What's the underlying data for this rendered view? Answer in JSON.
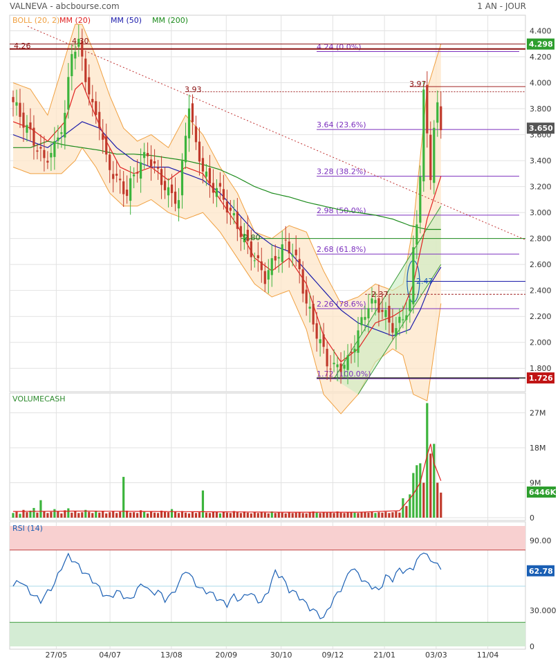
{
  "header": {
    "title": "VALNEVA - abcbourse.com",
    "period": "1 AN - JOUR"
  },
  "colors": {
    "boll": "#f0a040",
    "boll_fill": "#fde6c8",
    "mm20": "#e02020",
    "mm50": "#1a1aaa",
    "mm200": "#1a8a1a",
    "up": "#3cb43c",
    "down": "#c0392b",
    "fib": "#7b2fbe",
    "price_badge": "#555555",
    "green_badge": "#2e9e2e",
    "red_badge": "#c01414",
    "rsi": "#1a5fb4",
    "rsi_upper_zone": "#f8d0d0",
    "rsi_lower_zone": "#d4ecd4",
    "grid": "#e2e2e2"
  },
  "chart_data": [
    {
      "type": "candlestick",
      "title": "VALNEVA",
      "legend": [
        "BOLL (20, 2)",
        "MM (20)",
        "MM (50)",
        "MM (200)"
      ],
      "ylim": [
        1.62,
        4.52
      ],
      "y_ticks": [
        "4.400",
        "4.200",
        "4.000",
        "3.800",
        "3.600",
        "3.400",
        "3.200",
        "3.000",
        "2.800",
        "2.600",
        "2.400",
        "2.200",
        "2.000",
        "1.800"
      ],
      "x_ticks": [
        "27/05",
        "04/07",
        "13/08",
        "20/09",
        "30/10",
        "09/12",
        "21/01",
        "03/03",
        "11/04"
      ],
      "close_path": [
        [
          0,
          3.85
        ],
        [
          3,
          3.7
        ],
        [
          6,
          3.55
        ],
        [
          9,
          3.4
        ],
        [
          12,
          3.5
        ],
        [
          15,
          3.75
        ],
        [
          17,
          4.25
        ],
        [
          19,
          4.3
        ],
        [
          21,
          4.05
        ],
        [
          23,
          3.8
        ],
        [
          25,
          3.7
        ],
        [
          27,
          3.4
        ],
        [
          30,
          3.25
        ],
        [
          33,
          3.15
        ],
        [
          36,
          3.35
        ],
        [
          39,
          3.45
        ],
        [
          42,
          3.3
        ],
        [
          45,
          3.15
        ],
        [
          48,
          3.1
        ],
        [
          50,
          3.6
        ],
        [
          51,
          3.85
        ],
        [
          53,
          3.5
        ],
        [
          55,
          3.35
        ],
        [
          57,
          3.2
        ],
        [
          59,
          3.2
        ],
        [
          61,
          3.1
        ],
        [
          63,
          3.0
        ],
        [
          65,
          2.9
        ],
        [
          67,
          2.8
        ],
        [
          69,
          2.7
        ],
        [
          71,
          2.6
        ],
        [
          73,
          2.5
        ],
        [
          75,
          2.6
        ],
        [
          77,
          2.7
        ],
        [
          79,
          2.75
        ],
        [
          81,
          2.7
        ],
        [
          83,
          2.55
        ],
        [
          85,
          2.3
        ],
        [
          87,
          2.15
        ],
        [
          89,
          2.0
        ],
        [
          91,
          1.85
        ],
        [
          93,
          1.8
        ],
        [
          95,
          1.82
        ],
        [
          97,
          1.85
        ],
        [
          99,
          2.0
        ],
        [
          101,
          2.15
        ],
        [
          103,
          2.3
        ],
        [
          105,
          2.3
        ],
        [
          107,
          2.25
        ],
        [
          109,
          2.15
        ],
        [
          111,
          2.1
        ],
        [
          113,
          2.2
        ],
        [
          115,
          2.3
        ],
        [
          116,
          2.7
        ],
        [
          117,
          2.95
        ],
        [
          118,
          3.3
        ],
        [
          119,
          3.9
        ],
        [
          120,
          3.6
        ],
        [
          121,
          3.3
        ],
        [
          122,
          3.65
        ],
        [
          123,
          3.8
        ],
        [
          124,
          3.65
        ]
      ],
      "mm20_path": [
        [
          0,
          3.7
        ],
        [
          5,
          3.65
        ],
        [
          10,
          3.55
        ],
        [
          15,
          3.7
        ],
        [
          18,
          3.95
        ],
        [
          20,
          4.0
        ],
        [
          23,
          3.8
        ],
        [
          27,
          3.55
        ],
        [
          31,
          3.35
        ],
        [
          35,
          3.3
        ],
        [
          40,
          3.35
        ],
        [
          45,
          3.25
        ],
        [
          50,
          3.35
        ],
        [
          55,
          3.3
        ],
        [
          60,
          3.1
        ],
        [
          65,
          2.9
        ],
        [
          70,
          2.65
        ],
        [
          75,
          2.55
        ],
        [
          80,
          2.65
        ],
        [
          85,
          2.45
        ],
        [
          90,
          2.05
        ],
        [
          95,
          1.85
        ],
        [
          100,
          1.95
        ],
        [
          105,
          2.15
        ],
        [
          110,
          2.2
        ],
        [
          113,
          2.25
        ],
        [
          116,
          2.45
        ],
        [
          120,
          2.95
        ],
        [
          124,
          3.28
        ]
      ],
      "mm50_path": [
        [
          0,
          3.6
        ],
        [
          5,
          3.55
        ],
        [
          10,
          3.5
        ],
        [
          15,
          3.6
        ],
        [
          20,
          3.7
        ],
        [
          25,
          3.65
        ],
        [
          30,
          3.5
        ],
        [
          35,
          3.4
        ],
        [
          40,
          3.35
        ],
        [
          45,
          3.35
        ],
        [
          50,
          3.3
        ],
        [
          55,
          3.25
        ],
        [
          60,
          3.15
        ],
        [
          65,
          3.0
        ],
        [
          70,
          2.85
        ],
        [
          75,
          2.75
        ],
        [
          80,
          2.7
        ],
        [
          85,
          2.55
        ],
        [
          90,
          2.4
        ],
        [
          95,
          2.25
        ],
        [
          100,
          2.15
        ],
        [
          105,
          2.1
        ],
        [
          110,
          2.05
        ],
        [
          115,
          2.1
        ],
        [
          118,
          2.25
        ],
        [
          121,
          2.45
        ],
        [
          124,
          2.58
        ]
      ],
      "mm200_path": [
        [
          0,
          3.5
        ],
        [
          5,
          3.5
        ],
        [
          10,
          3.55
        ],
        [
          15,
          3.52
        ],
        [
          20,
          3.5
        ],
        [
          25,
          3.48
        ],
        [
          30,
          3.45
        ],
        [
          35,
          3.45
        ],
        [
          40,
          3.44
        ],
        [
          45,
          3.42
        ],
        [
          50,
          3.4
        ],
        [
          55,
          3.37
        ],
        [
          60,
          3.33
        ],
        [
          65,
          3.27
        ],
        [
          70,
          3.2
        ],
        [
          75,
          3.15
        ],
        [
          80,
          3.12
        ],
        [
          85,
          3.08
        ],
        [
          90,
          3.05
        ],
        [
          95,
          3.02
        ],
        [
          100,
          3.0
        ],
        [
          105,
          2.98
        ],
        [
          110,
          2.95
        ],
        [
          115,
          2.9
        ],
        [
          120,
          2.87
        ],
        [
          124,
          2.87
        ]
      ],
      "boll_upper_path": [
        [
          0,
          4.0
        ],
        [
          5,
          3.95
        ],
        [
          10,
          3.75
        ],
        [
          14,
          4.1
        ],
        [
          18,
          4.45
        ],
        [
          20,
          4.45
        ],
        [
          24,
          4.2
        ],
        [
          28,
          3.9
        ],
        [
          32,
          3.65
        ],
        [
          36,
          3.55
        ],
        [
          40,
          3.6
        ],
        [
          45,
          3.5
        ],
        [
          50,
          3.75
        ],
        [
          55,
          3.6
        ],
        [
          60,
          3.35
        ],
        [
          65,
          3.15
        ],
        [
          70,
          2.85
        ],
        [
          75,
          2.8
        ],
        [
          80,
          2.9
        ],
        [
          85,
          2.85
        ],
        [
          90,
          2.55
        ],
        [
          95,
          2.3
        ],
        [
          100,
          2.35
        ],
        [
          105,
          2.45
        ],
        [
          110,
          2.4
        ],
        [
          113,
          2.45
        ],
        [
          116,
          2.9
        ],
        [
          120,
          3.95
        ],
        [
          124,
          4.3
        ]
      ],
      "boll_lower_path": [
        [
          0,
          3.35
        ],
        [
          5,
          3.3
        ],
        [
          10,
          3.3
        ],
        [
          14,
          3.3
        ],
        [
          18,
          3.4
        ],
        [
          20,
          3.5
        ],
        [
          24,
          3.35
        ],
        [
          28,
          3.15
        ],
        [
          32,
          3.05
        ],
        [
          36,
          3.05
        ],
        [
          40,
          3.1
        ],
        [
          45,
          3.0
        ],
        [
          50,
          2.95
        ],
        [
          55,
          3.0
        ],
        [
          60,
          2.85
        ],
        [
          65,
          2.65
        ],
        [
          70,
          2.45
        ],
        [
          75,
          2.35
        ],
        [
          80,
          2.4
        ],
        [
          85,
          2.1
        ],
        [
          90,
          1.6
        ],
        [
          95,
          1.45
        ],
        [
          100,
          1.6
        ],
        [
          105,
          1.85
        ],
        [
          110,
          1.95
        ],
        [
          113,
          1.9
        ],
        [
          116,
          1.6
        ],
        [
          120,
          1.55
        ],
        [
          124,
          2.3
        ]
      ],
      "fibonacci": [
        {
          "price": 4.24,
          "label": "4.24  (0.0%)"
        },
        {
          "price": 3.64,
          "label": "3.64  (23.6%)"
        },
        {
          "price": 3.28,
          "label": "3.28  (38.2%)"
        },
        {
          "price": 2.98,
          "label": "2.98  (50.0%)"
        },
        {
          "price": 2.68,
          "label": "2.68  (61.8%)"
        },
        {
          "price": 2.26,
          "label": "2.26  (78.6%)"
        },
        {
          "price": 1.72,
          "label": "1.72  (100.0%)"
        }
      ],
      "annotations": [
        {
          "price": 4.26,
          "label": "4.26"
        },
        {
          "price": 4.3,
          "label": "4.30"
        },
        {
          "price": 3.93,
          "label": "3.93"
        },
        {
          "price": 3.97,
          "label": "3.97"
        },
        {
          "price": 2.8,
          "label": "2.80"
        },
        {
          "price": 2.37,
          "label": "2.37"
        },
        {
          "price": 2.47,
          "label": "2.47"
        }
      ],
      "price_badges": [
        {
          "value": "4.298",
          "price": 4.298,
          "color": "green"
        },
        {
          "value": "3.650",
          "price": 3.65,
          "color": "grey"
        },
        {
          "value": "1.726",
          "price": 1.726,
          "color": "red"
        }
      ]
    },
    {
      "type": "bar",
      "title": "VOLUMECASH",
      "ylim": [
        0,
        31
      ],
      "y_ticks": [
        "27M",
        "18M",
        "9M",
        "0"
      ],
      "badge": "6446K",
      "values": [
        1.2,
        1.5,
        1.0,
        2.0,
        1.4,
        1.8,
        2.5,
        1.3,
        3.0,
        1.7,
        1.2,
        1.5,
        2.2,
        1.6,
        1.1,
        1.9,
        2.4,
        1.3,
        1.7,
        1.2,
        1.4,
        2.0,
        1.5,
        1.2,
        1.8,
        1.3,
        1.6,
        1.1,
        1.4,
        1.7,
        1.2,
        1.5,
        2.5,
        1.8,
        1.3,
        1.4,
        1.2,
        1.9,
        1.5,
        1.1,
        1.6,
        1.3,
        1.2,
        1.8,
        1.5,
        1.4,
        2.2,
        1.6,
        1.2,
        1.7,
        1.3,
        1.1,
        1.5,
        1.2,
        1.4,
        1.8,
        1.3,
        1.2,
        1.6,
        1.4,
        1.1,
        1.5,
        1.3,
        1.2,
        1.7,
        1.4,
        1.2,
        1.6,
        1.3,
        1.1,
        1.5,
        1.2,
        1.4,
        1.3,
        1.1,
        1.6,
        1.2,
        1.5,
        1.3,
        1.1,
        1.4,
        1.2,
        1.3,
        1.5,
        1.2,
        1.1,
        1.4,
        1.6,
        1.3,
        1.2,
        1.5,
        1.3,
        1.4,
        1.2,
        1.6,
        1.3,
        1.2,
        1.5,
        1.4,
        1.3,
        1.2,
        1.4,
        1.5,
        1.3,
        1.6,
        1.2,
        1.4,
        1.3,
        1.5,
        1.2,
        1.4,
        1.6,
        1.3,
        2.0,
        3.0,
        6.0,
        10.0,
        7.0,
        14.0,
        9.0,
        29.0,
        12.0,
        19.0,
        9.0,
        6.45
      ],
      "spikes": [
        [
          8,
          4.5
        ],
        [
          32,
          10.5
        ],
        [
          55,
          7.0
        ],
        [
          113,
          5.0
        ],
        [
          116,
          11.5
        ],
        [
          117,
          13.5
        ],
        [
          120,
          29.5
        ],
        [
          121,
          16.5
        ]
      ],
      "colors_up": [
        0,
        2,
        5,
        6,
        8,
        12,
        16,
        21,
        24,
        32,
        38,
        46,
        55,
        60,
        75,
        88,
        99,
        105,
        113,
        115,
        116,
        117,
        118,
        120,
        122
      ],
      "average_path": [
        [
          0,
          1.6
        ],
        [
          20,
          1.7
        ],
        [
          40,
          1.6
        ],
        [
          60,
          1.5
        ],
        [
          80,
          1.4
        ],
        [
          100,
          1.4
        ],
        [
          112,
          1.8
        ],
        [
          116,
          6.0
        ],
        [
          118,
          9.0
        ],
        [
          120,
          16.0
        ],
        [
          121,
          19.0
        ],
        [
          122,
          14.0
        ],
        [
          124,
          9.5
        ]
      ]
    },
    {
      "type": "line",
      "title": "RSI (14)",
      "ylim": [
        0,
        100
      ],
      "y_ticks": [
        "90.00",
        "30.000",
        "0"
      ],
      "badge": "62.78",
      "upper_zone": [
        80,
        100
      ],
      "lower_zone": [
        0,
        20
      ],
      "midline": 50,
      "values_path": [
        [
          0,
          50
        ],
        [
          2,
          55
        ],
        [
          4,
          48
        ],
        [
          6,
          42
        ],
        [
          8,
          38
        ],
        [
          10,
          45
        ],
        [
          12,
          52
        ],
        [
          14,
          66
        ],
        [
          16,
          75
        ],
        [
          18,
          70
        ],
        [
          20,
          63
        ],
        [
          22,
          58
        ],
        [
          24,
          52
        ],
        [
          26,
          44
        ],
        [
          28,
          40
        ],
        [
          30,
          46
        ],
        [
          32,
          42
        ],
        [
          34,
          38
        ],
        [
          36,
          48
        ],
        [
          38,
          52
        ],
        [
          40,
          44
        ],
        [
          42,
          46
        ],
        [
          44,
          39
        ],
        [
          46,
          43
        ],
        [
          48,
          52
        ],
        [
          50,
          64
        ],
        [
          52,
          56
        ],
        [
          54,
          48
        ],
        [
          56,
          46
        ],
        [
          58,
          43
        ],
        [
          60,
          38
        ],
        [
          62,
          35
        ],
        [
          64,
          42
        ],
        [
          66,
          38
        ],
        [
          68,
          45
        ],
        [
          70,
          41
        ],
        [
          72,
          36
        ],
        [
          74,
          47
        ],
        [
          76,
          62
        ],
        [
          78,
          57
        ],
        [
          80,
          47
        ],
        [
          82,
          44
        ],
        [
          84,
          38
        ],
        [
          86,
          32
        ],
        [
          88,
          28
        ],
        [
          90,
          23
        ],
        [
          92,
          35
        ],
        [
          94,
          44
        ],
        [
          96,
          52
        ],
        [
          98,
          66
        ],
        [
          100,
          60
        ],
        [
          102,
          53
        ],
        [
          104,
          50
        ],
        [
          106,
          46
        ],
        [
          108,
          58
        ],
        [
          110,
          56
        ],
        [
          112,
          64
        ],
        [
          114,
          62
        ],
        [
          116,
          66
        ],
        [
          118,
          75
        ],
        [
          119,
          80
        ],
        [
          121,
          70
        ],
        [
          122,
          72
        ],
        [
          124,
          63
        ]
      ]
    }
  ]
}
